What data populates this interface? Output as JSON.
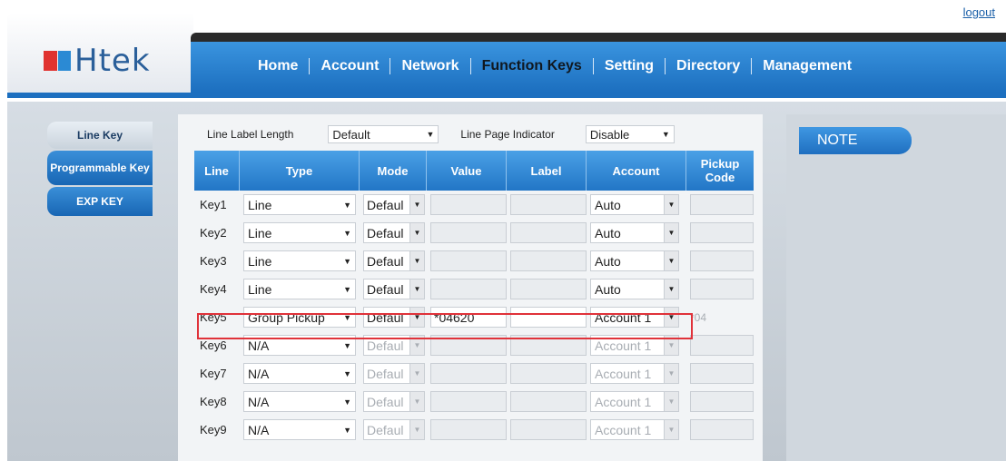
{
  "header": {
    "logout": "logout",
    "logo_text": "Htek",
    "nav": [
      {
        "label": "Home",
        "active": false
      },
      {
        "label": "Account",
        "active": false
      },
      {
        "label": "Network",
        "active": false
      },
      {
        "label": "Function Keys",
        "active": true
      },
      {
        "label": "Setting",
        "active": false
      },
      {
        "label": "Directory",
        "active": false
      },
      {
        "label": "Management",
        "active": false
      }
    ]
  },
  "sidebar": {
    "items": [
      {
        "label": "Line Key",
        "active": true
      },
      {
        "label": "Programmable Key",
        "active": false
      },
      {
        "label": "EXP KEY",
        "active": false
      }
    ]
  },
  "controls": {
    "line_label_length_label": "Line Label Length",
    "line_label_length_value": "Default",
    "line_page_indicator_label": "Line Page Indicator",
    "line_page_indicator_value": "Disable"
  },
  "table": {
    "headers": {
      "line": "Line",
      "type": "Type",
      "mode": "Mode",
      "value": "Value",
      "label": "Label",
      "account": "Account",
      "pickup": "Pickup Code"
    },
    "rows": [
      {
        "key": "Key1",
        "type": "Line",
        "mode": "Defaul",
        "value": "",
        "label": "",
        "account": "Auto",
        "pickup": "",
        "enabled": true
      },
      {
        "key": "Key2",
        "type": "Line",
        "mode": "Defaul",
        "value": "",
        "label": "",
        "account": "Auto",
        "pickup": "",
        "enabled": true
      },
      {
        "key": "Key3",
        "type": "Line",
        "mode": "Defaul",
        "value": "",
        "label": "",
        "account": "Auto",
        "pickup": "",
        "enabled": true
      },
      {
        "key": "Key4",
        "type": "Line",
        "mode": "Defaul",
        "value": "",
        "label": "",
        "account": "Auto",
        "pickup": "",
        "enabled": true
      },
      {
        "key": "Key5",
        "type": "Group Pickup",
        "mode": "Defaul",
        "value": "*04620",
        "label": "",
        "account": "Account 1",
        "pickup": "*04",
        "enabled": true,
        "highlighted": true
      },
      {
        "key": "Key6",
        "type": "N/A",
        "mode": "Defaul",
        "value": "",
        "label": "",
        "account": "Account 1",
        "pickup": "",
        "enabled": false
      },
      {
        "key": "Key7",
        "type": "N/A",
        "mode": "Defaul",
        "value": "",
        "label": "",
        "account": "Account 1",
        "pickup": "",
        "enabled": false
      },
      {
        "key": "Key8",
        "type": "N/A",
        "mode": "Defaul",
        "value": "",
        "label": "",
        "account": "Account 1",
        "pickup": "",
        "enabled": false
      },
      {
        "key": "Key9",
        "type": "N/A",
        "mode": "Defaul",
        "value": "",
        "label": "",
        "account": "Account 1",
        "pickup": "",
        "enabled": false
      }
    ]
  },
  "note": {
    "title": "NOTE"
  },
  "colors": {
    "brand_blue": "#1c6fbf",
    "highlight_red": "#e0323a",
    "logo_red": "#e0322f"
  }
}
